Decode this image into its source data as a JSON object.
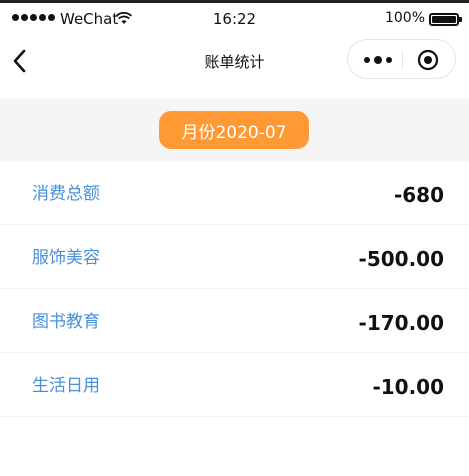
{
  "status_bar": {
    "carrier": "WeChat",
    "time": "16:22",
    "battery": "100%"
  },
  "nav": {
    "title": "账单统计"
  },
  "month": {
    "label": "月份2020-07"
  },
  "stats": [
    {
      "label": "消费总额",
      "value": "-680"
    },
    {
      "label": "服饰美容",
      "value": "-500.00"
    },
    {
      "label": "图书教育",
      "value": "-170.00"
    },
    {
      "label": "生活日用",
      "value": "-10.00"
    }
  ],
  "colors": {
    "accent": "#ff9933",
    "label": "#4a90d9",
    "band": "#f5f5f5"
  }
}
